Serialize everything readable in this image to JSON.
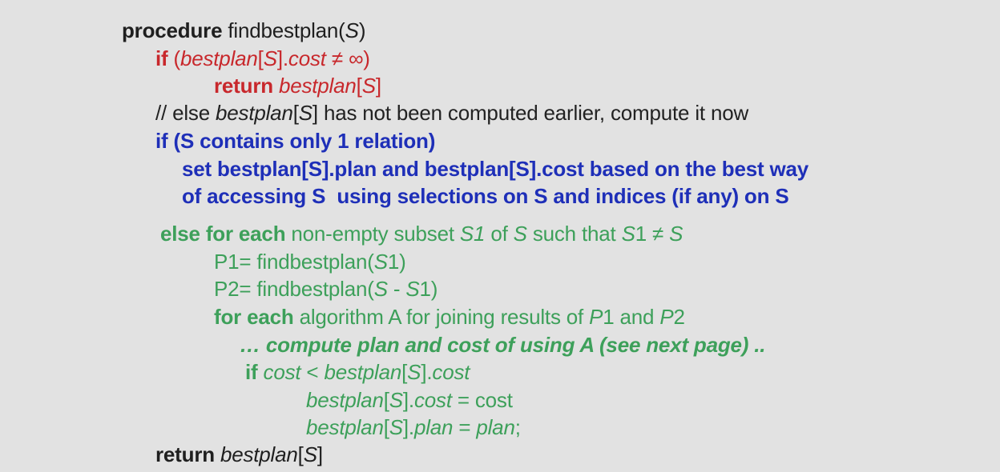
{
  "colors": {
    "background": "#e2e2e2",
    "black": "#1f1f1f",
    "red": "#c8282c",
    "blue": "#1e2fb8",
    "green": "#3da05a"
  },
  "lines": [
    {
      "segments": [
        {
          "text": "procedure",
          "style": "b black"
        },
        {
          "text": " findbestplan(",
          "style": "black"
        },
        {
          "text": "S",
          "style": "i black"
        },
        {
          "text": ")",
          "style": "black"
        }
      ]
    },
    {
      "segments": [
        {
          "text": "if",
          "style": "b red"
        },
        {
          "text": " (",
          "style": "red"
        },
        {
          "text": "bestplan",
          "style": "i red"
        },
        {
          "text": "[",
          "style": "red"
        },
        {
          "text": "S",
          "style": "i red"
        },
        {
          "text": "].",
          "style": "red"
        },
        {
          "text": "cost ≠ ∞",
          "style": "i red"
        },
        {
          "text": ")",
          "style": "red"
        }
      ]
    },
    {
      "segments": [
        {
          "text": "return",
          "style": "b red"
        },
        {
          "text": " ",
          "style": "red"
        },
        {
          "text": "bestplan",
          "style": "i red"
        },
        {
          "text": "[",
          "style": "red"
        },
        {
          "text": "S",
          "style": "i red"
        },
        {
          "text": "]",
          "style": "red"
        }
      ]
    },
    {
      "segments": [
        {
          "text": "// else ",
          "style": "dark"
        },
        {
          "text": "bestplan",
          "style": "i dark"
        },
        {
          "text": "[",
          "style": "dark"
        },
        {
          "text": "S",
          "style": "i dark"
        },
        {
          "text": "] has not been computed earlier, compute it now",
          "style": "dark"
        }
      ]
    },
    {
      "segments": [
        {
          "text": "if (S contains only 1 relation)",
          "style": "b blue"
        }
      ]
    },
    {
      "segments": [
        {
          "text": "set bestplan[S].plan and bestplan[S].cost based on the best way",
          "style": "b blue"
        }
      ]
    },
    {
      "segments": [
        {
          "text": "of accessing S  using selections on S and indices (if any) on S",
          "style": "b blue"
        }
      ]
    },
    {
      "segments": [
        {
          "text": "else for each",
          "style": "b green"
        },
        {
          "text": " non-empty subset ",
          "style": "green"
        },
        {
          "text": "S1",
          "style": "i green"
        },
        {
          "text": " of ",
          "style": "green"
        },
        {
          "text": "S",
          "style": "i green"
        },
        {
          "text": " such that ",
          "style": "green"
        },
        {
          "text": "S",
          "style": "i green"
        },
        {
          "text": "1 ≠ ",
          "style": "green"
        },
        {
          "text": "S",
          "style": "i green"
        }
      ]
    },
    {
      "segments": [
        {
          "text": "P1= findbestplan(",
          "style": "green"
        },
        {
          "text": "S",
          "style": "i green"
        },
        {
          "text": "1)",
          "style": "green"
        }
      ]
    },
    {
      "segments": [
        {
          "text": "P2= findbestplan(",
          "style": "green"
        },
        {
          "text": "S",
          "style": "i green"
        },
        {
          "text": " - ",
          "style": "green"
        },
        {
          "text": "S",
          "style": "i green"
        },
        {
          "text": "1)",
          "style": "green"
        }
      ]
    },
    {
      "segments": [
        {
          "text": "for each",
          "style": "b green"
        },
        {
          "text": " algorithm A for joining results of ",
          "style": "green"
        },
        {
          "text": "P",
          "style": "i green"
        },
        {
          "text": "1 and ",
          "style": "green"
        },
        {
          "text": "P",
          "style": "i green"
        },
        {
          "text": "2",
          "style": "green"
        }
      ]
    },
    {
      "segments": [
        {
          "text": "… compute plan and cost of using A (see next page) ..",
          "style": "b i green"
        }
      ]
    },
    {
      "segments": [
        {
          "text": "if",
          "style": "b green"
        },
        {
          "text": " ",
          "style": "green"
        },
        {
          "text": "cost",
          "style": "i green"
        },
        {
          "text": " < ",
          "style": "green"
        },
        {
          "text": "bestplan",
          "style": "i green"
        },
        {
          "text": "[",
          "style": "green"
        },
        {
          "text": "S",
          "style": "i green"
        },
        {
          "text": "].",
          "style": "green"
        },
        {
          "text": "cost",
          "style": "i green"
        }
      ]
    },
    {
      "segments": [
        {
          "text": "bestplan",
          "style": "i green"
        },
        {
          "text": "[",
          "style": "green"
        },
        {
          "text": "S",
          "style": "i green"
        },
        {
          "text": "].",
          "style": "green"
        },
        {
          "text": "cost",
          "style": "i green"
        },
        {
          "text": " = cost",
          "style": "green"
        }
      ]
    },
    {
      "segments": [
        {
          "text": "bestplan",
          "style": "i green"
        },
        {
          "text": "[",
          "style": "green"
        },
        {
          "text": "S",
          "style": "i green"
        },
        {
          "text": "].",
          "style": "green"
        },
        {
          "text": "plan",
          "style": "i green"
        },
        {
          "text": " = ",
          "style": "green"
        },
        {
          "text": "plan",
          "style": "i green"
        },
        {
          "text": ";",
          "style": "green"
        }
      ]
    },
    {
      "segments": [
        {
          "text": "return",
          "style": "b black"
        },
        {
          "text": " ",
          "style": "black"
        },
        {
          "text": "bestplan",
          "style": "i black"
        },
        {
          "text": "[",
          "style": "black"
        },
        {
          "text": "S",
          "style": "i black"
        },
        {
          "text": "]",
          "style": "black"
        }
      ]
    }
  ]
}
